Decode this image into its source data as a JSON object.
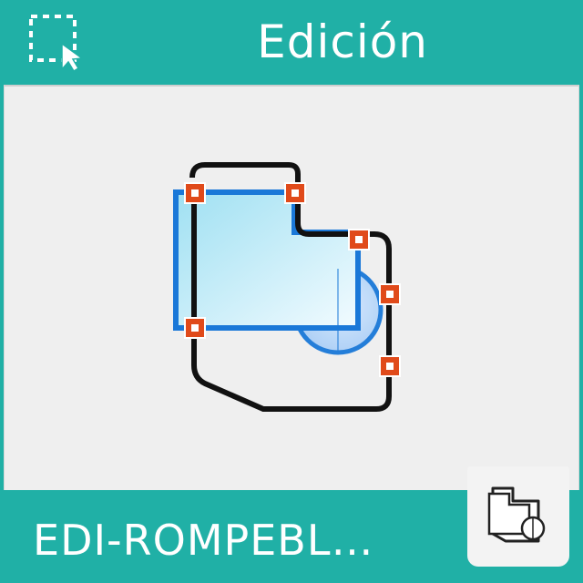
{
  "header": {
    "title": "Edición",
    "select_icon": "selection-cursor-icon"
  },
  "content": {
    "main_icon": "edit-break-shape-icon"
  },
  "footer": {
    "label": "EDI-ROMPEBL…",
    "thumbnail_icon": "shape-thumbnail-icon"
  },
  "colors": {
    "teal": "#20b0a6",
    "panel": "#efefef",
    "grip": "#e04a1a",
    "blue": "#1a78d8"
  }
}
